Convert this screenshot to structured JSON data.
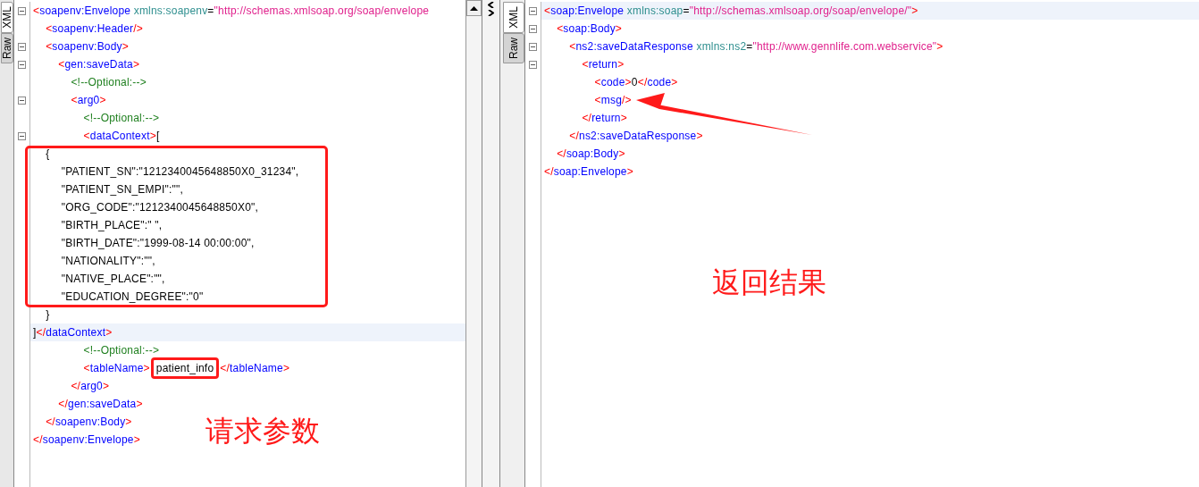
{
  "panels": [
    {
      "tabs": [
        {
          "label": "XML",
          "selected": true
        },
        {
          "label": "Raw",
          "selected": false
        }
      ],
      "lines": [
        {
          "fold": true,
          "current": false,
          "tokens": [
            {
              "kind": "bracket",
              "text": "<"
            },
            {
              "kind": "tag",
              "text": "soapenv:Envelope"
            },
            {
              "kind": "attr",
              "text": " xmlns:soapenv"
            },
            {
              "kind": "plain",
              "text": "="
            },
            {
              "kind": "value",
              "text": "\"http://schemas.xmlsoap.org/soap/envelope"
            }
          ]
        },
        {
          "fold": false,
          "current": false,
          "tokens": [
            {
              "kind": "bracket",
              "text": "    <"
            },
            {
              "kind": "tag",
              "text": "soapenv:Header"
            },
            {
              "kind": "bracket",
              "text": "/>"
            }
          ]
        },
        {
          "fold": true,
          "current": false,
          "tokens": [
            {
              "kind": "bracket",
              "text": "    <"
            },
            {
              "kind": "tag",
              "text": "soapenv:Body"
            },
            {
              "kind": "bracket",
              "text": ">"
            }
          ]
        },
        {
          "fold": true,
          "current": false,
          "tokens": [
            {
              "kind": "bracket",
              "text": "        <"
            },
            {
              "kind": "tag",
              "text": "gen:saveData"
            },
            {
              "kind": "bracket",
              "text": ">"
            }
          ]
        },
        {
          "fold": false,
          "current": false,
          "tokens": [
            {
              "kind": "comment",
              "text": "            <!--Optional:-->"
            }
          ]
        },
        {
          "fold": true,
          "current": false,
          "tokens": [
            {
              "kind": "bracket",
              "text": "            <"
            },
            {
              "kind": "tag",
              "text": "arg0"
            },
            {
              "kind": "bracket",
              "text": ">"
            }
          ]
        },
        {
          "fold": false,
          "current": false,
          "tokens": [
            {
              "kind": "comment",
              "text": "                <!--Optional:-->"
            }
          ]
        },
        {
          "fold": true,
          "current": false,
          "tokens": [
            {
              "kind": "bracket",
              "text": "                <"
            },
            {
              "kind": "tag",
              "text": "dataContext"
            },
            {
              "kind": "bracket",
              "text": ">"
            },
            {
              "kind": "plain",
              "text": "["
            }
          ]
        },
        {
          "fold": false,
          "current": false,
          "tokens": [
            {
              "kind": "plain",
              "text": "    {"
            }
          ]
        },
        {
          "fold": false,
          "current": false,
          "tokens": [
            {
              "kind": "plain",
              "text": "         \"PATIENT_SN\":\"1212340045648850X0_31234\","
            }
          ]
        },
        {
          "fold": false,
          "current": false,
          "tokens": [
            {
              "kind": "plain",
              "text": "         \"PATIENT_SN_EMPI\":\"\","
            }
          ]
        },
        {
          "fold": false,
          "current": false,
          "tokens": [
            {
              "kind": "plain",
              "text": "         \"ORG_CODE\":\"1212340045648850X0\","
            }
          ]
        },
        {
          "fold": false,
          "current": false,
          "tokens": [
            {
              "kind": "plain",
              "text": "         \"BIRTH_PLACE\":\" \","
            }
          ]
        },
        {
          "fold": false,
          "current": false,
          "tokens": [
            {
              "kind": "plain",
              "text": "         \"BIRTH_DATE\":\"1999-08-14 00:00:00\","
            }
          ]
        },
        {
          "fold": false,
          "current": false,
          "tokens": [
            {
              "kind": "plain",
              "text": "         \"NATIONALITY\":\"\","
            }
          ]
        },
        {
          "fold": false,
          "current": false,
          "tokens": [
            {
              "kind": "plain",
              "text": "         \"NATIVE_PLACE\":\"\","
            }
          ]
        },
        {
          "fold": false,
          "current": false,
          "tokens": [
            {
              "kind": "plain",
              "text": "         \"EDUCATION_DEGREE\":\"0\""
            }
          ]
        },
        {
          "fold": false,
          "current": false,
          "tokens": [
            {
              "kind": "plain",
              "text": "    }"
            }
          ]
        },
        {
          "fold": false,
          "current": true,
          "tokens": [
            {
              "kind": "plain",
              "text": "]"
            },
            {
              "kind": "bracket",
              "text": "</"
            },
            {
              "kind": "tag",
              "text": "dataContext"
            },
            {
              "kind": "bracket",
              "text": ">"
            }
          ]
        },
        {
          "fold": false,
          "current": false,
          "tokens": [
            {
              "kind": "comment",
              "text": "                <!--Optional:-->"
            }
          ]
        },
        {
          "fold": false,
          "current": false,
          "tokens": [
            {
              "kind": "bracket",
              "text": "                <"
            },
            {
              "kind": "tag",
              "text": "tableName"
            },
            {
              "kind": "bracket",
              "text": ">"
            },
            {
              "kind": "plain",
              "text": "patient_info"
            },
            {
              "kind": "bracket",
              "text": "</"
            },
            {
              "kind": "tag",
              "text": "tableName"
            },
            {
              "kind": "bracket",
              "text": ">"
            }
          ]
        },
        {
          "fold": false,
          "current": false,
          "tokens": [
            {
              "kind": "bracket",
              "text": "            </"
            },
            {
              "kind": "tag",
              "text": "arg0"
            },
            {
              "kind": "bracket",
              "text": ">"
            }
          ]
        },
        {
          "fold": false,
          "current": false,
          "tokens": [
            {
              "kind": "bracket",
              "text": "        </"
            },
            {
              "kind": "tag",
              "text": "gen:saveData"
            },
            {
              "kind": "bracket",
              "text": ">"
            }
          ]
        },
        {
          "fold": false,
          "current": false,
          "tokens": [
            {
              "kind": "bracket",
              "text": "    </"
            },
            {
              "kind": "tag",
              "text": "soapenv:Body"
            },
            {
              "kind": "bracket",
              "text": ">"
            }
          ]
        },
        {
          "fold": false,
          "current": false,
          "tokens": [
            {
              "kind": "bracket",
              "text": "</"
            },
            {
              "kind": "tag",
              "text": "soapenv:Envelope"
            },
            {
              "kind": "bracket",
              "text": ">"
            }
          ]
        }
      ]
    },
    {
      "tabs": [
        {
          "label": "XML",
          "selected": true
        },
        {
          "label": "Raw",
          "selected": false
        }
      ],
      "lines": [
        {
          "fold": true,
          "current": true,
          "tokens": [
            {
              "kind": "bracket",
              "text": "<"
            },
            {
              "kind": "tag",
              "text": "soap:Envelope"
            },
            {
              "kind": "attr",
              "text": " xmlns:soap"
            },
            {
              "kind": "plain",
              "text": "="
            },
            {
              "kind": "value",
              "text": "\"http://schemas.xmlsoap.org/soap/envelope/\""
            },
            {
              "kind": "bracket",
              "text": ">"
            }
          ]
        },
        {
          "fold": true,
          "current": false,
          "tokens": [
            {
              "kind": "bracket",
              "text": "    <"
            },
            {
              "kind": "tag",
              "text": "soap:Body"
            },
            {
              "kind": "bracket",
              "text": ">"
            }
          ]
        },
        {
          "fold": true,
          "current": false,
          "tokens": [
            {
              "kind": "bracket",
              "text": "        <"
            },
            {
              "kind": "tag",
              "text": "ns2:saveDataResponse"
            },
            {
              "kind": "attr",
              "text": " xmlns:ns2"
            },
            {
              "kind": "plain",
              "text": "="
            },
            {
              "kind": "value",
              "text": "\"http://www.gennlife.com.webservice\""
            },
            {
              "kind": "bracket",
              "text": ">"
            }
          ]
        },
        {
          "fold": true,
          "current": false,
          "tokens": [
            {
              "kind": "bracket",
              "text": "            <"
            },
            {
              "kind": "tag",
              "text": "return"
            },
            {
              "kind": "bracket",
              "text": ">"
            }
          ]
        },
        {
          "fold": false,
          "current": false,
          "tokens": [
            {
              "kind": "bracket",
              "text": "                <"
            },
            {
              "kind": "tag",
              "text": "code"
            },
            {
              "kind": "bracket",
              "text": ">"
            },
            {
              "kind": "plain",
              "text": "0"
            },
            {
              "kind": "bracket",
              "text": "</"
            },
            {
              "kind": "tag",
              "text": "code"
            },
            {
              "kind": "bracket",
              "text": ">"
            }
          ]
        },
        {
          "fold": false,
          "current": false,
          "tokens": [
            {
              "kind": "bracket",
              "text": "                <"
            },
            {
              "kind": "tag",
              "text": "msg"
            },
            {
              "kind": "bracket",
              "text": "/>"
            }
          ]
        },
        {
          "fold": false,
          "current": false,
          "tokens": [
            {
              "kind": "bracket",
              "text": "            </"
            },
            {
              "kind": "tag",
              "text": "return"
            },
            {
              "kind": "bracket",
              "text": ">"
            }
          ]
        },
        {
          "fold": false,
          "current": false,
          "tokens": [
            {
              "kind": "bracket",
              "text": "        </"
            },
            {
              "kind": "tag",
              "text": "ns2:saveDataResponse"
            },
            {
              "kind": "bracket",
              "text": ">"
            }
          ]
        },
        {
          "fold": false,
          "current": false,
          "tokens": [
            {
              "kind": "bracket",
              "text": "    </"
            },
            {
              "kind": "tag",
              "text": "soap:Body"
            },
            {
              "kind": "bracket",
              "text": ">"
            }
          ]
        },
        {
          "fold": false,
          "current": false,
          "tokens": [
            {
              "kind": "bracket",
              "text": "</"
            },
            {
              "kind": "tag",
              "text": "soap:Envelope"
            },
            {
              "kind": "bracket",
              "text": ">"
            }
          ]
        }
      ]
    }
  ],
  "annotations": [
    {
      "kind": "label",
      "text": "请求参数"
    },
    {
      "kind": "label",
      "text": "返回结果"
    }
  ]
}
